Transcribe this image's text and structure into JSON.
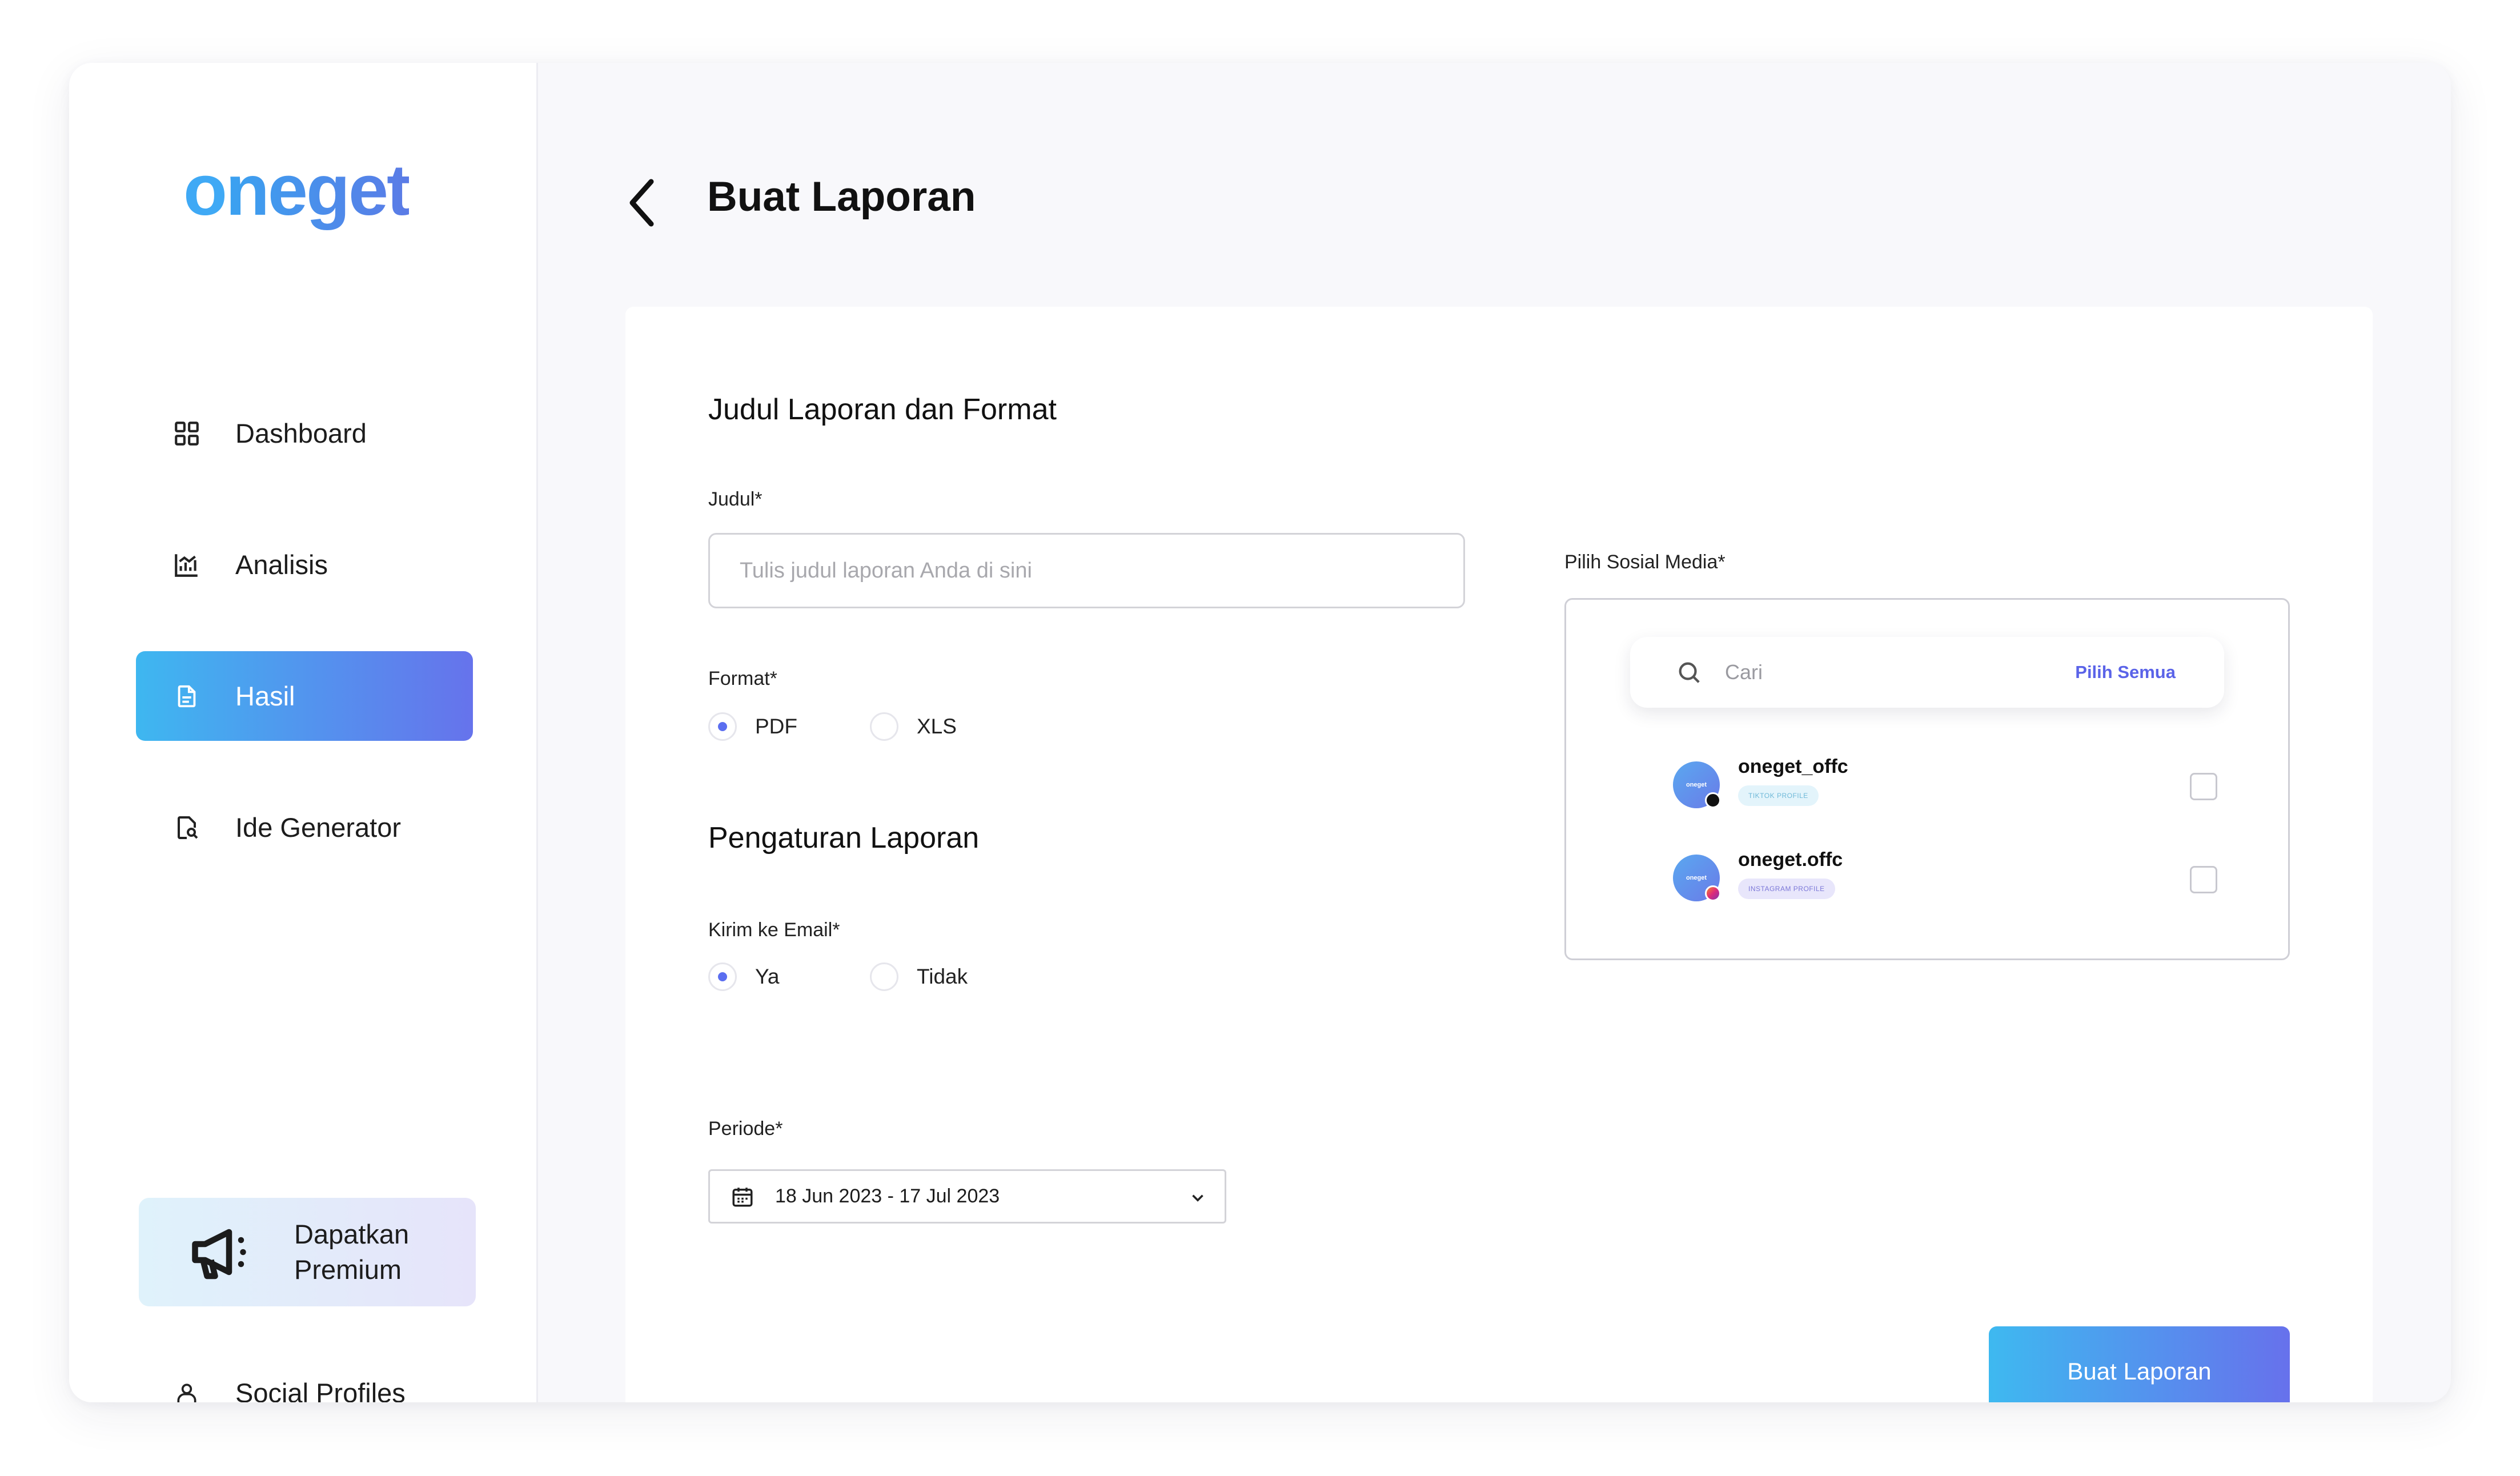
{
  "brand": {
    "logo_o": "o",
    "logo_rest": "neget"
  },
  "sidebar": {
    "items": [
      {
        "label": "Dashboard",
        "icon": "dashboard-grid-icon",
        "active": false
      },
      {
        "label": "Analisis",
        "icon": "analytics-chart-icon",
        "active": false
      },
      {
        "label": "Hasil",
        "icon": "document-icon",
        "active": true
      },
      {
        "label": "Ide Generator",
        "icon": "document-search-icon",
        "active": false
      }
    ],
    "premium": {
      "line1": "Dapatkan",
      "line2": "Premium",
      "icon": "megaphone-icon"
    },
    "social_profiles": {
      "label": "Social Profiles",
      "icon": "user-icon"
    }
  },
  "header": {
    "title": "Buat Laporan",
    "back_icon": "chevron-left-icon"
  },
  "form": {
    "section1_title": "Judul Laporan dan Format",
    "judul_label": "Judul*",
    "judul_placeholder": "Tulis judul laporan Anda di sini",
    "judul_value": "",
    "format_label": "Format*",
    "format_options": [
      {
        "label": "PDF",
        "selected": true
      },
      {
        "label": "XLS",
        "selected": false
      }
    ],
    "section2_title": "Pengaturan Laporan",
    "email_label": "Kirim ke Email*",
    "email_options": [
      {
        "label": "Ya",
        "selected": true
      },
      {
        "label": "Tidak",
        "selected": false
      }
    ],
    "periode_label": "Periode*",
    "periode_value": "18 Jun 2023 - 17 Jul 2023",
    "social_label": "Pilih Sosial Media*",
    "search_placeholder": "Cari",
    "select_all": "Pilih Semua",
    "accounts": [
      {
        "name": "oneget_offc",
        "tag": "TIKTOK PROFILE",
        "avatar_text": "oneget",
        "checked": false
      },
      {
        "name": "oneget.offc",
        "tag": "INSTAGRAM PROFILE",
        "avatar_text": "oneget",
        "checked": false
      }
    ],
    "submit_label": "Buat Laporan"
  },
  "colors": {
    "accent_start": "#3eb7f0",
    "accent_end": "#6673ec",
    "tiktok_tag_bg": "#e3f4fb",
    "tiktok_tag_fg": "#6fb9d8",
    "instagram_tag_bg": "#e8e6fb",
    "instagram_tag_fg": "#7c78d8"
  }
}
